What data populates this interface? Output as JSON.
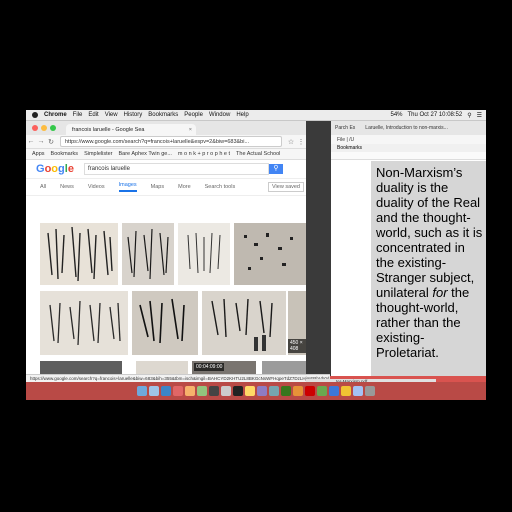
{
  "menubar": {
    "app": "Chrome",
    "items": [
      "File",
      "Edit",
      "View",
      "History",
      "Bookmarks",
      "People",
      "Window",
      "Help"
    ],
    "datetime": "Thu Oct 27  10:08:52",
    "battery": "54%"
  },
  "left_window": {
    "tab_title": "francois laruelle - Google Sea",
    "url": "https://www.google.com/search?q=francois+laruelle&espv=2&biw=683&bi...",
    "bookmarks": [
      "Apps",
      "Bookmarks",
      "Simplelister",
      "Bare Aphex Twin ge...",
      "m o n k + p r o p h e t",
      "The Actual School"
    ],
    "search_query": "francois laruelle",
    "tabs": [
      "All",
      "News",
      "Videos",
      "Images",
      "Maps",
      "More",
      "Search tools"
    ],
    "active_tab": "Images",
    "view_saved": "View saved",
    "badges": {
      "size": "450 × 408",
      "timer": "00:04:09:00"
    },
    "status_url": "https://www.google.com/search?q=francois+laruelle&biw=683&bih=355&tbm=isch&imgil=BAHCYD2KHTU2L8BKGcNsWFHqpeTdZ7DzLHjmFRhVh0d..."
  },
  "right_window": {
    "tab1": "Parch Es",
    "tab2": "Laruelle, Introduction to non-marxis...",
    "url": "File | /U",
    "bookmarks": "Bookmarks",
    "pdf_label": "ter-Marxism.pdf"
  },
  "slide": {
    "line1": "Non-Marxism’s duality is the duality of the Real and the thought-world, such as it is concentrated in the existing-Stranger subject, unilateral ",
    "emphasis": "for",
    "line2": " the thought-world, rather than the existing-Proletariat."
  },
  "colors": {
    "desktop": "#d9534f",
    "slide_bg": "#d6d6d6",
    "google_blue": "#4285f4"
  }
}
